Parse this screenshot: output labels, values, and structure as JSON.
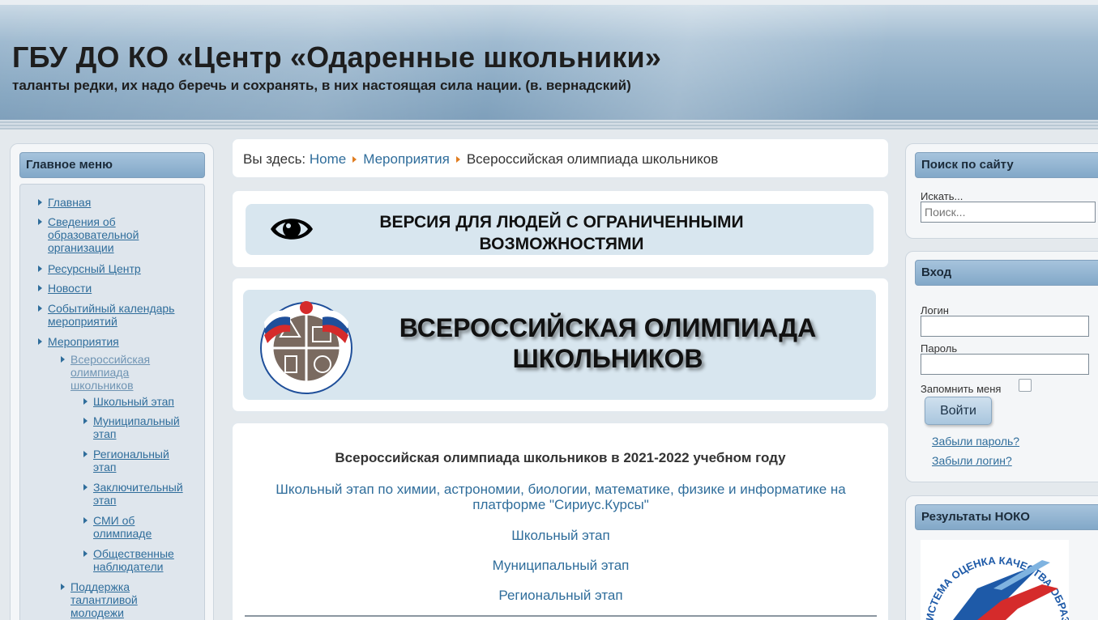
{
  "header": {
    "title": "ГБУ ДО КО «Центр «Одаренные школьники»",
    "slogan": "таланты редки, их надо беречь и сохранять, в них настоящая сила нации. (в. вернадский)"
  },
  "main_menu": {
    "title": "Главное меню",
    "items": [
      {
        "label": "Главная"
      },
      {
        "label": "Сведения об образовательной организации"
      },
      {
        "label": "Ресурсный Центр"
      },
      {
        "label": "Новости"
      },
      {
        "label": "Событийный календарь мероприятий"
      },
      {
        "label": "Мероприятия"
      },
      {
        "label": "Всероссийская олимпиада школьников"
      },
      {
        "label": "Школьный этап"
      },
      {
        "label": "Муниципальный этап"
      },
      {
        "label": "Региональный этап"
      },
      {
        "label": "Заключительный этап"
      },
      {
        "label": "СМИ об олимпиаде"
      },
      {
        "label": "Общественные наблюдатели"
      },
      {
        "label": "Поддержка талантливой молодежи"
      }
    ]
  },
  "breadcrumb": {
    "prefix": "Вы здесь:",
    "items": [
      "Home",
      "Мероприятия",
      "Всероссийская олимпиада школьников"
    ]
  },
  "accessibility_banner": {
    "text": "ВЕРСИЯ ДЛЯ ЛЮДЕЙ С ОГРАНИЧЕННЫМИ ВОЗМОЖНОСТЯМИ",
    "icon": "eye-icon"
  },
  "olympiad_banner": {
    "title": "ВСЕРОССИЙСКАЯ ОЛИМПИАДА ШКОЛЬНИКОВ",
    "logo_text": "ВСЕРОССИЙСКАЯ ОЛИМПИАДА ШКОЛЬНИКОВ"
  },
  "content": {
    "heading": "Всероссийская олимпиада школьников в 2021-2022 учебном году",
    "links": [
      "Школьный этап по химии, астрономии, биологии, математике, физике и информатике на платформе \"Сириус.Курсы\"",
      "Школьный этап",
      "Муниципальный этап",
      "Региональный этап"
    ]
  },
  "search": {
    "title": "Поиск по сайту",
    "label": "Искать...",
    "placeholder": "Поиск..."
  },
  "login": {
    "title": "Вход",
    "login_label": "Логин",
    "password_label": "Пароль",
    "remember_label": "Запомнить меня",
    "submit_label": "Войти",
    "forgot_password": "Забыли пароль?",
    "forgot_login": "Забыли логин?"
  },
  "noko": {
    "title": "Результаты НОКО",
    "image_text": "СИСТЕМА ОЦЕНКА КАЧЕСТВА ОБРАЗ"
  },
  "colors": {
    "link": "#2f6d9b",
    "panel_title": "#82a8c8",
    "banner_bg": "#d8e6ef",
    "breadcrumb_arrow": "#e07c1f"
  }
}
